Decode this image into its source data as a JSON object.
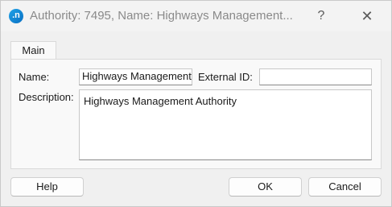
{
  "window": {
    "app_icon_glyph": ".n",
    "title": "Authority: 7495, Name: Highways Management...",
    "help_glyph": "?",
    "close_glyph": "✕"
  },
  "tabs": [
    {
      "label": "Main",
      "selected": true
    }
  ],
  "form": {
    "name_label": "Name:",
    "name_value": "Highways Management",
    "external_id_label": "External ID:",
    "external_id_value": "",
    "description_label": "Description:",
    "description_value": "Highways Management Authority"
  },
  "buttons": {
    "help": "Help",
    "ok": "OK",
    "cancel": "Cancel"
  }
}
